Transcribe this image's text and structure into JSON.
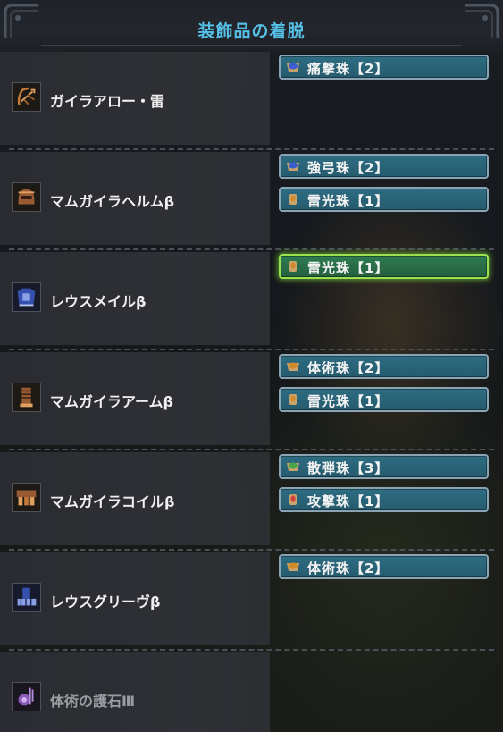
{
  "title": "装飾品の着脱",
  "colors": {
    "title": "#55bfe6",
    "slot_fill": "#2a6478",
    "slot_border": "#8aa4b4",
    "selected_border": "#9be04f",
    "gem_blue": "#3b5fcf",
    "gem_orange": "#d08a2a",
    "gem_green": "#4aa64a",
    "gem_red": "#d24040"
  },
  "equipment": [
    {
      "name": "ガイラアロー・雷",
      "icon": "bow-icon",
      "slots": [
        {
          "label": "痛撃珠【2】",
          "gem": "blue"
        }
      ]
    },
    {
      "name": "マムガイラヘルムβ",
      "icon": "helm-icon",
      "slots": [
        {
          "label": "強弓珠【2】",
          "gem": "blue"
        },
        {
          "label": "雷光珠【1】",
          "gem": "orange"
        }
      ]
    },
    {
      "name": "レウスメイルβ",
      "icon": "chest-icon",
      "slots": [
        {
          "label": "雷光珠【1】",
          "gem": "orange",
          "selected": true
        }
      ]
    },
    {
      "name": "マムガイラアームβ",
      "icon": "arms-icon",
      "slots": [
        {
          "label": "体術珠【2】",
          "gem": "orange"
        },
        {
          "label": "雷光珠【1】",
          "gem": "orange"
        }
      ]
    },
    {
      "name": "マムガイラコイルβ",
      "icon": "waist-icon",
      "slots": [
        {
          "label": "散弾珠【3】",
          "gem": "green"
        },
        {
          "label": "攻撃珠【1】",
          "gem": "red"
        }
      ]
    },
    {
      "name": "レウスグリーヴβ",
      "icon": "legs-icon",
      "slots": [
        {
          "label": "体術珠【2】",
          "gem": "orange"
        }
      ]
    },
    {
      "name": "体術の護石Ⅲ",
      "icon": "charm-icon",
      "slots": []
    }
  ]
}
